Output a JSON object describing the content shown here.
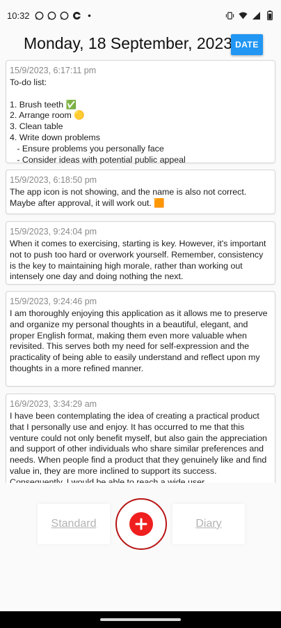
{
  "status_bar": {
    "time": "10:32",
    "icons_left": [
      "whatsapp-icon",
      "whatsapp-icon",
      "whatsapp-icon",
      "app-icon",
      "dot-icon"
    ],
    "icons_right": [
      "vibrate-icon",
      "wifi-icon",
      "signal-icon",
      "battery-icon"
    ]
  },
  "header": {
    "date_title": "Monday, 18 September, 2023",
    "date_button_label": "DATE",
    "date_button_color": "#2196f3"
  },
  "notes": [
    {
      "timestamp": "15/9/2023, 6:17:11 pm",
      "body": "To-do list:\n\n1. Brush teeth ✅\n2. Arrange room 🟡\n3. Clean table\n4. Write down problems\n   - Ensure problems you personally face\n   - Consider ideas with potential public appeal"
    },
    {
      "timestamp": "15/9/2023, 6:18:50 pm",
      "body": "The app icon is not showing, and the name is also not correct. Maybe after approval, it will work out. 🟧"
    },
    {
      "timestamp": "15/9/2023, 9:24:04 pm",
      "body": "When it comes to exercising, starting is key. However, it's important not to push too hard or overwork yourself. Remember, consistency is the key to maintaining high morale, rather than working out intensely one day and doing nothing the next."
    },
    {
      "timestamp": "15/9/2023, 9:24:46 pm",
      "body": "I am thoroughly enjoying this application as it allows me to preserve and organize my personal thoughts in a beautiful, elegant, and proper English format, making them even more valuable when revisited. This serves both my need for self-expression and the practicality of being able to easily understand and reflect upon my thoughts in a more refined manner."
    },
    {
      "timestamp": "16/9/2023, 3:34:29 am",
      "body": "I have been contemplating the idea of creating a practical product that I personally use and enjoy. It has occurred to me that this venture could not only benefit myself, but also gain the appreciation and support of other individuals who share similar preferences and needs. When people find a product that they genuinely like and find value in, they are more inclined to support its success. Consequently, I would be able to reach a wide user"
    }
  ],
  "bottom_bar": {
    "tab_standard_label": "Standard",
    "tab_diary_label": "Diary",
    "add_button_icon": "plus-icon",
    "accent_color": "#ef1f1f"
  }
}
